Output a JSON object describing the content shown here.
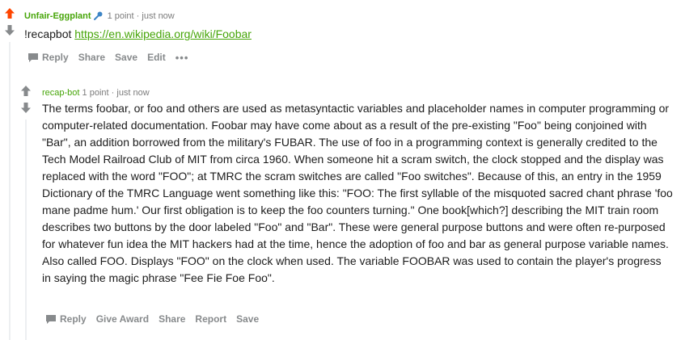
{
  "top_comment": {
    "author": "Unfair-Eggplant",
    "points": "1 point",
    "separator": "·",
    "time": "just now",
    "command": "!recapbot",
    "link": "https://en.wikipedia.org/wiki/Foobar",
    "actions": {
      "reply": "Reply",
      "share": "Share",
      "save": "Save",
      "edit": "Edit",
      "more": "•••"
    },
    "colors": {
      "upvote_active": "#ff4500",
      "author": "#46a508"
    }
  },
  "reply_comment": {
    "author": "recap-bot",
    "points": "1 point",
    "separator": "·",
    "time": "just now",
    "body": "The terms foobar, or foo and others are used as metasyntactic variables and placeholder names in computer programming or computer-related documentation. Foobar may have come about as a result of the pre-existing \"Foo\" being conjoined with \"Bar\", an addition borrowed from the military's FUBAR. The use of foo in a programming context is generally credited to the Tech Model Railroad Club of MIT from circa 1960. When someone hit a scram switch, the clock stopped and the display was replaced with the word \"FOO\"; at TMRC the scram switches are called \"Foo switches\". Because of this, an entry in the 1959 Dictionary of the TMRC Language went something like this: \"FOO: The first syllable of the misquoted sacred chant phrase 'foo mane padme hum.' Our first obligation is to keep the foo counters turning.\" One book[which?] describing the MIT train room describes two buttons by the door labeled \"Foo\" and \"Bar\". These were general purpose buttons and were often re-purposed for whatever fun idea the MIT hackers had at the time, hence the adoption of foo and bar as general purpose variable names. Also called FOO. Displays \"FOO\" on the clock when used. The variable FOOBAR was used to contain the player's progress in saying the magic phrase \"Fee Fie Foe Foo\".",
    "actions": {
      "reply": "Reply",
      "give_award": "Give Award",
      "share": "Share",
      "report": "Report",
      "save": "Save"
    }
  },
  "icons": {
    "upvote": "upvote-arrow-icon",
    "downvote": "downvote-arrow-icon",
    "flair": "pin-icon",
    "comment": "speech-bubble-icon"
  }
}
